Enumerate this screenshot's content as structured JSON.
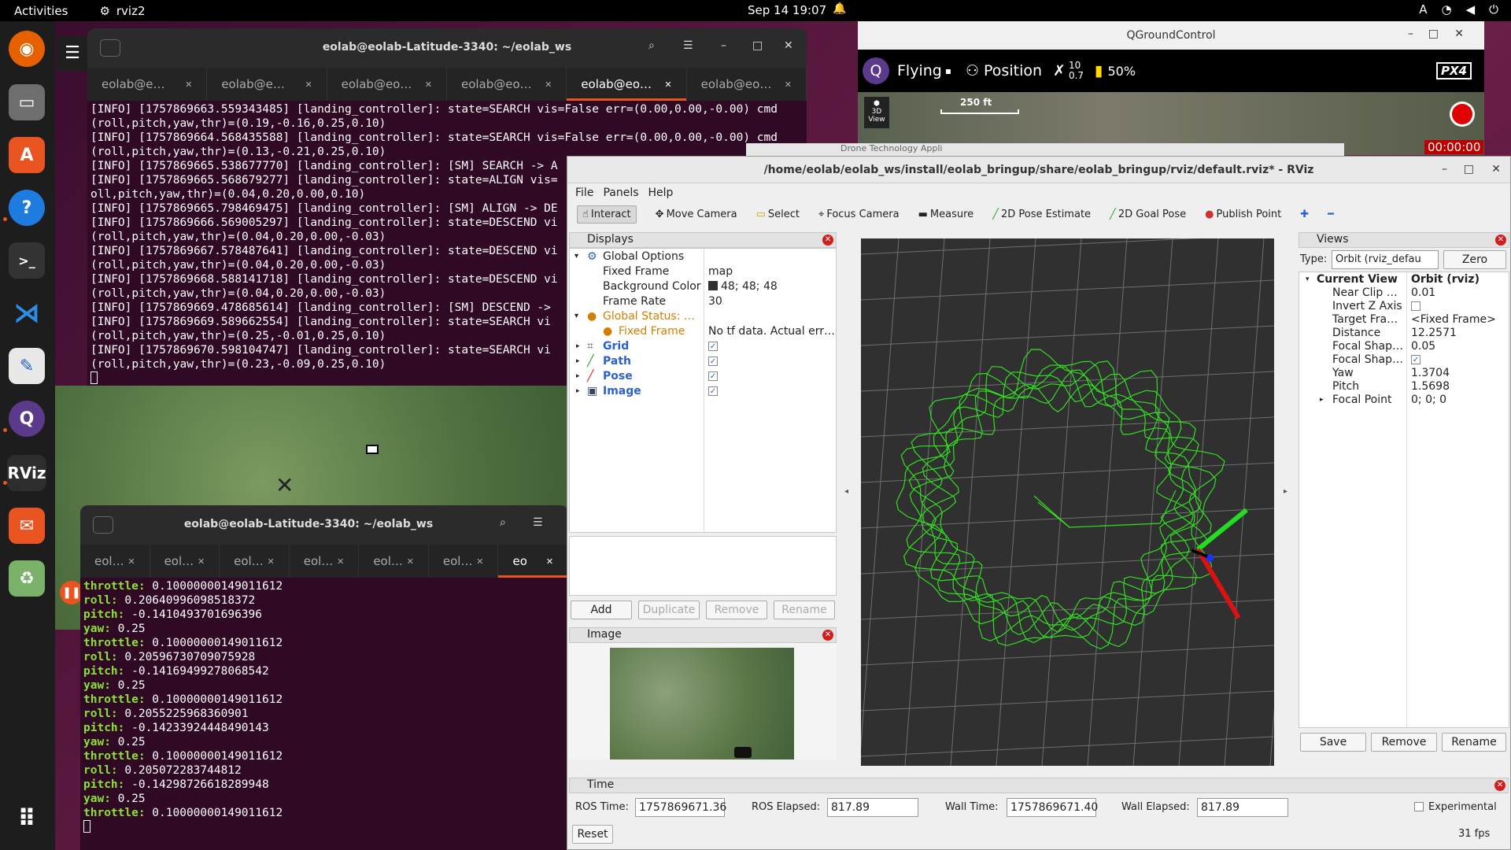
{
  "topbar": {
    "activities": "Activities",
    "app_name": "rviz2",
    "clock": "Sep 14  19:07",
    "tray_a": "A",
    "tray_icons": [
      "wifi-icon",
      "volume-icon",
      "power-icon"
    ]
  },
  "dock": {
    "items": [
      "firefox",
      "files",
      "app-center",
      "help",
      "terminal",
      "vscode",
      "text-editor",
      "qgroundcontrol",
      "rviz",
      "transmission",
      "trash"
    ],
    "rviz_label": "RViz",
    "apps_grid": "apps-grid-icon"
  },
  "term1": {
    "title": "eolab@eolab-Latitude-3340: ~/eolab_ws",
    "tabs": [
      "eolab@e…",
      "eolab@e…",
      "eolab@eo…",
      "eolab@eo…",
      "eolab@eo…",
      "eolab@eo…"
    ],
    "lines": [
      "[INFO] [1757869663.559343485] [landing_controller]: state=SEARCH vis=False err=(0.00,0.00,-0.00) cmd",
      "(roll,pitch,yaw,thr)=(0.19,-0.16,0.25,0.10)",
      "[INFO] [1757869664.568435588] [landing_controller]: state=SEARCH vis=False err=(0.00,0.00,-0.00) cmd",
      "(roll,pitch,yaw,thr)=(0.13,-0.21,0.25,0.10)",
      "[INFO] [1757869665.538677770] [landing_controller]: [SM] SEARCH -> A",
      "[INFO] [1757869665.568679277] [landing_controller]: state=ALIGN vis=",
      "oll,pitch,yaw,thr)=(0.04,0.20,0.00,0.10)",
      "[INFO] [1757869665.798469475] [landing_controller]: [SM] ALIGN -> DE",
      "[INFO] [1757869666.569005297] [landing_controller]: state=DESCEND vi",
      "(roll,pitch,yaw,thr)=(0.04,0.20,0.00,-0.03)",
      "[INFO] [1757869667.578487641] [landing_controller]: state=DESCEND vi",
      "(roll,pitch,yaw,thr)=(0.04,0.20,0.00,-0.03)",
      "[INFO] [1757869668.588141718] [landing_controller]: state=DESCEND vi",
      "(roll,pitch,yaw,thr)=(0.04,0.20,0.00,-0.03)",
      "[INFO] [1757869669.478685614] [landing_controller]: [SM] DESCEND ->",
      "[INFO] [1757869669.589662554] [landing_controller]: state=SEARCH vi",
      "(roll,pitch,yaw,thr)=(0.25,-0.01,0.25,0.10)",
      "[INFO] [1757869670.598104747] [landing_controller]: state=SEARCH vi",
      "(roll,pitch,yaw,thr)=(0.23,-0.09,0.25,0.10)"
    ]
  },
  "term2": {
    "title": "eolab@eolab-Latitude-3340: ~/eolab_ws",
    "tabs": [
      "eol…",
      "eol…",
      "eol…",
      "eol…",
      "eol…",
      "eol…",
      "eo"
    ],
    "lines": [
      [
        "throttle:",
        "0.10000000149011612"
      ],
      [
        "roll:",
        "0.20640996098518372"
      ],
      [
        "pitch:",
        "-0.1410493701696396"
      ],
      [
        "yaw:",
        "0.25"
      ],
      [
        "throttle:",
        "0.10000000149011612"
      ],
      [
        "roll:",
        "0.20596730709075928"
      ],
      [
        "pitch:",
        "-0.14169499278068542"
      ],
      [
        "yaw:",
        "0.25"
      ],
      [
        "throttle:",
        "0.10000000149011612"
      ],
      [
        "roll:",
        "0.2055225968360901"
      ],
      [
        "pitch:",
        "-0.14233924448490143"
      ],
      [
        "yaw:",
        "0.25"
      ],
      [
        "throttle:",
        "0.10000000149011612"
      ],
      [
        "roll:",
        "0.205072283744812"
      ],
      [
        "pitch:",
        "-0.14298726618289948"
      ],
      [
        "yaw:",
        "0.25"
      ],
      [
        "throttle:",
        "0.10000000149011612"
      ]
    ]
  },
  "qgc": {
    "title": "QGroundControl",
    "flight_state": "Flying",
    "mode": "Position",
    "sats": "10",
    "hdop": "0.7",
    "battery": "50%",
    "scale": "250 ft",
    "view3d": "3D View",
    "timer": "00:00:00",
    "logo": "PX4",
    "browser_tab": "Drone Technology Appli"
  },
  "rviz": {
    "title": "/home/eolab/eolab_ws/install/eolab_bringup/share/eolab_bringup/rviz/default.rviz* - RViz",
    "menu": [
      "File",
      "Panels",
      "Help"
    ],
    "tools": [
      "Interact",
      "Move Camera",
      "Select",
      "Focus Camera",
      "Measure",
      "2D Pose Estimate",
      "2D Goal Pose",
      "Publish Point"
    ],
    "displays": {
      "header": "Displays",
      "global_options": "Global Options",
      "fixed_frame_k": "Fixed Frame",
      "fixed_frame_v": "map",
      "bg_k": "Background Color",
      "bg_v": "48; 48; 48",
      "rate_k": "Frame Rate",
      "rate_v": "30",
      "status_k": "Global Status: …",
      "status_ff_k": "Fixed Frame",
      "status_ff_v": "No tf data.  Actual err…",
      "items": [
        "Grid",
        "Path",
        "Pose",
        "Image"
      ],
      "add": "Add",
      "duplicate": "Duplicate",
      "remove": "Remove",
      "rename": "Rename"
    },
    "image_panel": "Image",
    "views": {
      "header": "Views",
      "type_label": "Type:",
      "type_value": "Orbit (rviz_defau",
      "zero": "Zero",
      "rows": [
        [
          "Current View",
          "Orbit (rviz)"
        ],
        [
          "Near Clip …",
          "0.01"
        ],
        [
          "Invert Z Axis",
          ""
        ],
        [
          "Target Fra…",
          "<Fixed Frame>"
        ],
        [
          "Distance",
          "12.2571"
        ],
        [
          "Focal Shap…",
          "0.05"
        ],
        [
          "Focal Shap…",
          ""
        ],
        [
          "Yaw",
          "1.3704"
        ],
        [
          "Pitch",
          "1.5698"
        ],
        [
          "Focal Point",
          "0; 0; 0"
        ]
      ],
      "save": "Save",
      "remove": "Remove",
      "rename": "Rename"
    },
    "time": {
      "header": "Time",
      "ros_time_l": "ROS Time:",
      "ros_time": "1757869671.36",
      "ros_elapsed_l": "ROS Elapsed:",
      "ros_elapsed": "817.89",
      "wall_time_l": "Wall Time:",
      "wall_time": "1757869671.40",
      "wall_elapsed_l": "Wall Elapsed:",
      "wall_elapsed": "817.89",
      "experimental": "Experimental",
      "reset": "Reset",
      "fps": "31 fps"
    }
  },
  "colors": {
    "path": "#33dd22",
    "grid": "#8a8a8a",
    "bg": "#303030",
    "accent": "#e95420"
  }
}
